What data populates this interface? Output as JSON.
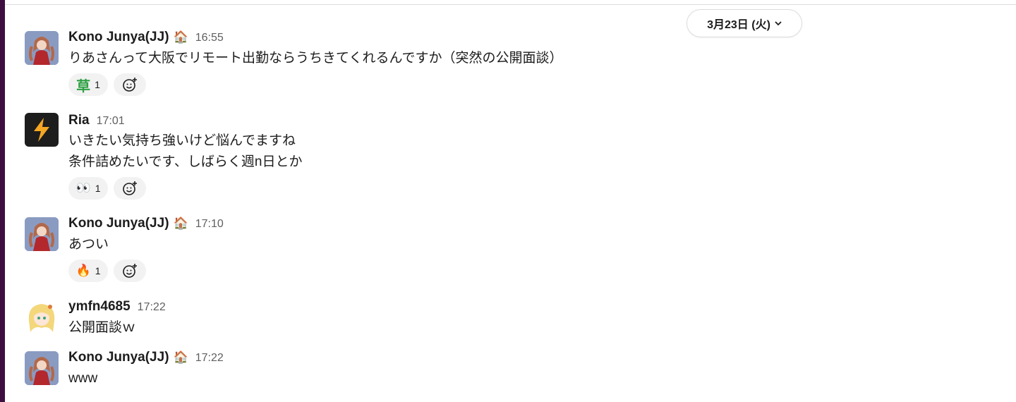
{
  "date_divider": {
    "label": "3月23日 (火)",
    "chevron_icon": "chevron-down-icon"
  },
  "messages": [
    {
      "author": "Kono Junya(JJ)",
      "status_emoji": "🏠",
      "time": "16:55",
      "lines": [
        "りあさんって大阪でリモート出勤ならうちきてくれるんですか（突然の公開面談）"
      ],
      "reaction": {
        "emoji": "草",
        "count": "1"
      }
    },
    {
      "author": "Ria",
      "time": "17:01",
      "lines": [
        "いきたい気持ち強いけど悩んでますね",
        "条件詰めたいです、しばらく週n日とか"
      ],
      "reaction": {
        "emoji": "👀",
        "count": "1"
      }
    },
    {
      "author": "Kono Junya(JJ)",
      "status_emoji": "🏠",
      "time": "17:10",
      "lines": [
        "あつい"
      ],
      "reaction": {
        "emoji": "🔥",
        "count": "1"
      }
    },
    {
      "author": "ymfn4685",
      "time": "17:22",
      "lines": [
        "公開面談ｗ"
      ]
    },
    {
      "author": "Kono Junya(JJ)",
      "status_emoji": "🏠",
      "time": "17:22",
      "lines": [
        "www"
      ]
    }
  ],
  "colors": {
    "sidebar": "#3f0e40",
    "reaction_bg": "#f2f2f2",
    "ria_avatar_bg": "#1d1d1d",
    "lightning": "#f5a623",
    "kusa": "#2ea043"
  }
}
